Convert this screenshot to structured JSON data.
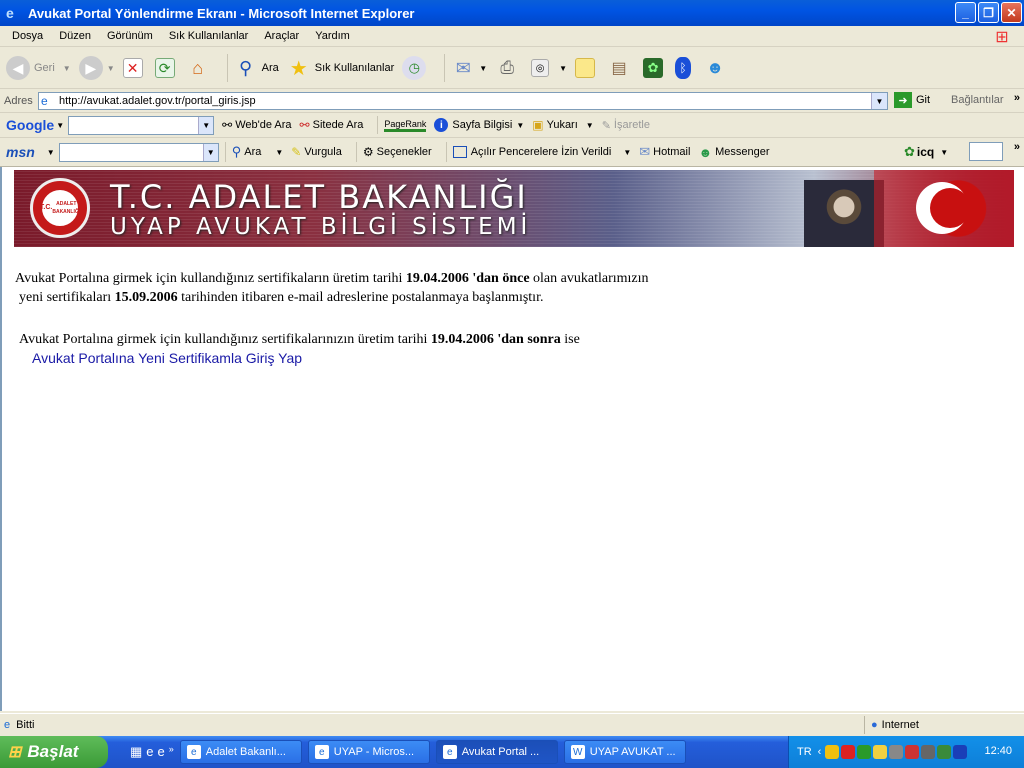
{
  "window": {
    "title": "Avukat Portal Yönlendirme Ekranı - Microsoft Internet Explorer"
  },
  "menu": [
    "Dosya",
    "Düzen",
    "Görünüm",
    "Sık Kullanılanlar",
    "Araçlar",
    "Yardım"
  ],
  "toolbar": {
    "back": "Geri",
    "search": "Ara",
    "favorites": "Sık Kullanılanlar"
  },
  "address": {
    "label": "Adres",
    "url": "http://avukat.adalet.gov.tr/portal_giris.jsp",
    "go": "Git",
    "links": "Bağlantılar"
  },
  "google": {
    "logo": "Google",
    "web_search": "Web'de Ara",
    "site_search": "Sitede Ara",
    "pagerank": "PageRank",
    "page_info": "Sayfa Bilgisi",
    "up": "Yukarı",
    "mark": "İşaretle"
  },
  "msn": {
    "logo": "msn",
    "search": "Ara",
    "highlight": "Vurgula",
    "options": "Seçenekler",
    "popups": "Açılır Pencerelere İzin Verildi",
    "hotmail": "Hotmail",
    "messenger": "Messenger",
    "icq": "icq"
  },
  "banner": {
    "title": "T.C. ADALET BAKANLIĞI",
    "subtitle": "UYAP AVUKAT BİLGİ SİSTEMİ",
    "seal_top": "T.C.",
    "seal_bottom": "ADALET BAKANLIĞI"
  },
  "content": {
    "p1_a": "Avukat Portalına girmek için kullandığınız sertifikaların üretim tarihi ",
    "p1_date": "19.04.2006 'dan önce",
    "p1_b": " olan avukatlarımızın",
    "p2_a": "yeni sertifikaları ",
    "p2_date": "15.09.2006",
    "p2_b": " tarihinden itibaren e-mail adreslerine postalanmaya başlanmıştır.",
    "p3_a": "Avukat Portalına girmek için kullandığınız sertifikalarınızın üretim tarihi ",
    "p3_date": "19.04.2006 'dan sonra",
    "p3_b": " ise",
    "link": "Avukat Portalına Yeni Sertifikamla Giriş Yap"
  },
  "status": {
    "text": "Bitti",
    "zone": "Internet"
  },
  "taskbar": {
    "start": "Başlat",
    "tasks": [
      "Adalet Bakanlı...",
      "UYAP - Micros...",
      "Avukat Portal ...",
      "UYAP AVUKAT ..."
    ],
    "lang": "TR",
    "clock": "12:40"
  },
  "colors": {
    "link": "#1a1aa6",
    "titlebar": "#0054e3",
    "taskbar": "#245edb",
    "start": "#3a9a36"
  }
}
